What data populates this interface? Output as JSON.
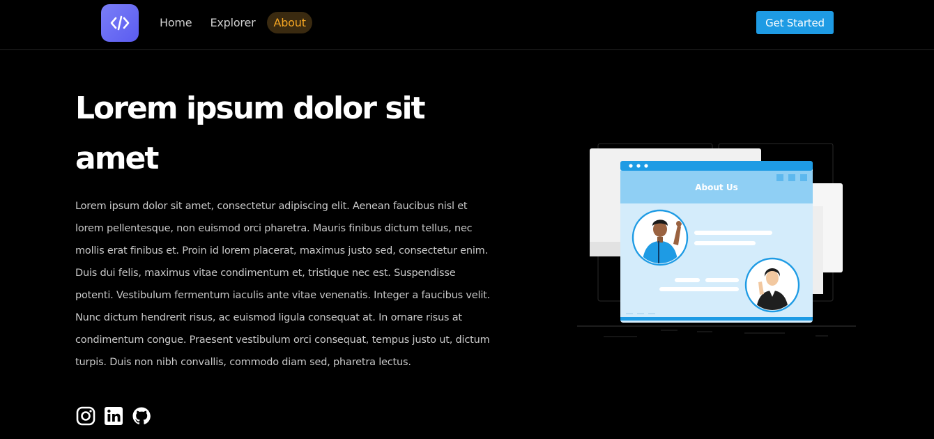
{
  "nav": {
    "links": [
      {
        "label": "Home"
      },
      {
        "label": "Explorer"
      },
      {
        "label": "About"
      }
    ],
    "active": "About",
    "cta_label": "Get Started",
    "logo_icon": "code-icon"
  },
  "hero": {
    "title": "Lorem ipsum dolor sit amet",
    "body": "Lorem ipsum dolor sit amet, consectetur adipiscing elit. Aenean faucibus nisl et lorem pellentesque, non euismod orci pharetra. Mauris finibus dictum tellus, nec mollis erat finibus et. Proin id lorem placerat, maximus justo sed, consectetur enim. Duis dui felis, maximus vitae condimentum et, tristique nec est. Suspendisse potenti.  Vestibulum fermentum iaculis ante vitae venenatis. Integer a faucibus velit. Nunc dictum hendrerit risus, ac euismod ligula consequat at. In ornare risus at condimentum congue. Praesent vestibulum orci consequat, tempus justo ut, dictum turpis. Duis non nibh convallis, commodo diam sed, pharetra lectus."
  },
  "socials": [
    {
      "icon": "instagram-icon"
    },
    {
      "icon": "linkedin-icon"
    },
    {
      "icon": "github-icon"
    }
  ],
  "illustration": {
    "window_title": "About Us"
  },
  "colors": {
    "background": "#000000",
    "accent": "#1e9be4",
    "active_nav": "#f5a623",
    "logo": "#6366f1"
  }
}
